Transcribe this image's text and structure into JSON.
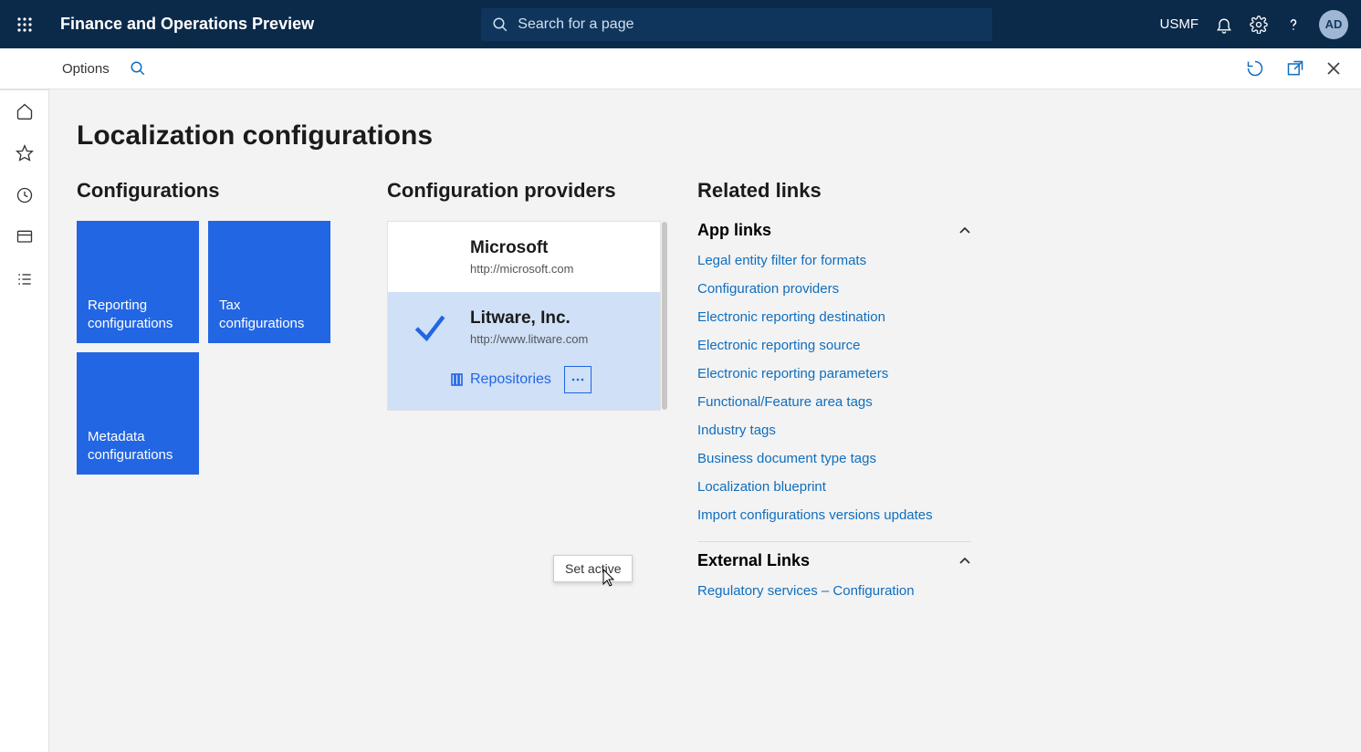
{
  "header": {
    "app_title": "Finance and Operations Preview",
    "search_placeholder": "Search for a page",
    "company": "USMF",
    "avatar_initials": "AD"
  },
  "subbar": {
    "options_label": "Options"
  },
  "page": {
    "title": "Localization configurations"
  },
  "configurations": {
    "heading": "Configurations",
    "tiles": [
      "Reporting configurations",
      "Tax configurations",
      "Metadata configurations"
    ]
  },
  "providers": {
    "heading": "Configuration providers",
    "items": [
      {
        "name": "Microsoft",
        "url": "http://microsoft.com"
      },
      {
        "name": "Litware, Inc.",
        "url": "http://www.litware.com"
      }
    ],
    "repositories_label": "Repositories",
    "popup_label": "Set active"
  },
  "related": {
    "heading": "Related links",
    "app_links_heading": "App links",
    "app_links": [
      "Legal entity filter for formats",
      "Configuration providers",
      "Electronic reporting destination",
      "Electronic reporting source",
      "Electronic reporting parameters",
      "Functional/Feature area tags",
      "Industry tags",
      "Business document type tags",
      "Localization blueprint",
      "Import configurations versions updates"
    ],
    "external_links_heading": "External Links",
    "external_links": [
      "Regulatory services – Configuration"
    ]
  }
}
